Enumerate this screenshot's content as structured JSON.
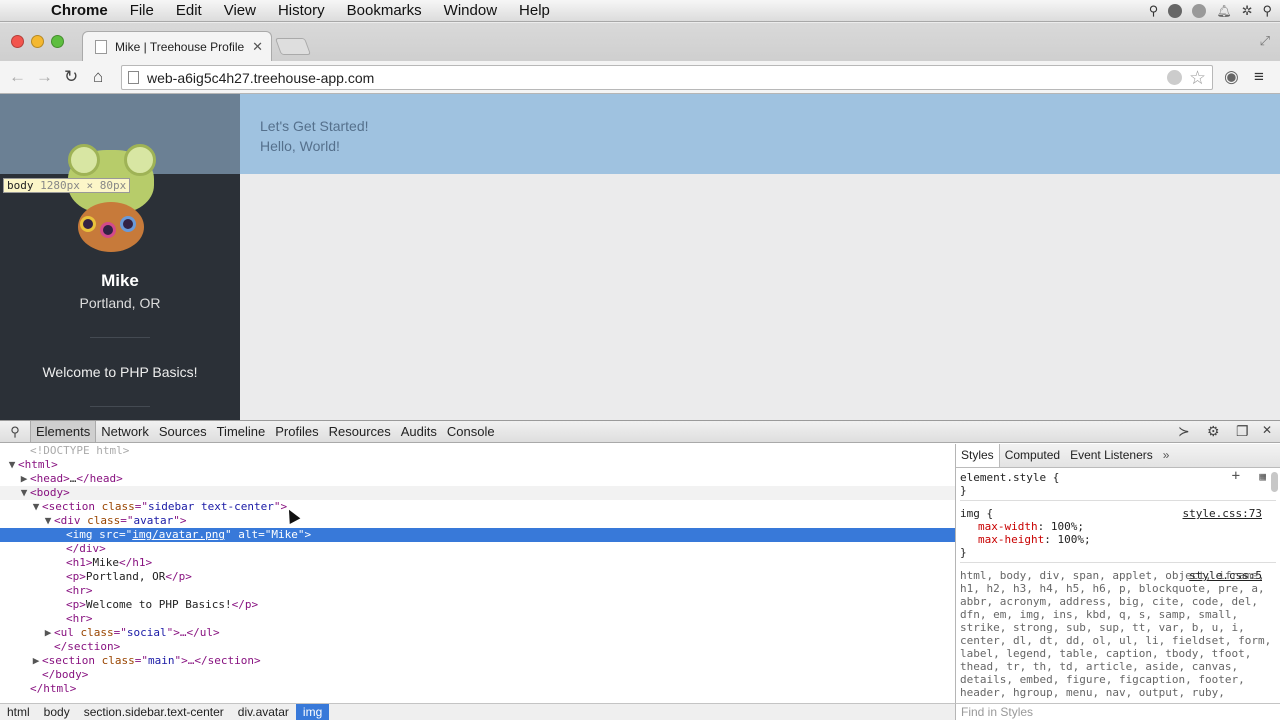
{
  "menubar": {
    "app": "Chrome",
    "items": [
      "File",
      "Edit",
      "View",
      "History",
      "Bookmarks",
      "Window",
      "Help"
    ]
  },
  "tab": {
    "title": "Mike | Treehouse Profile"
  },
  "toolbar": {
    "url": "web-a6ig5c4h27.treehouse-app.com"
  },
  "page": {
    "sidebar": {
      "name": "Mike",
      "location": "Portland, OR",
      "welcome": "Welcome to PHP Basics!"
    },
    "main": {
      "line1": "Let's Get Started!",
      "line2": "Hello, World!"
    },
    "tooltip": {
      "tag": "body",
      "size": "1280px × 80px"
    }
  },
  "devtools": {
    "tabs": [
      "Elements",
      "Network",
      "Sources",
      "Timeline",
      "Profiles",
      "Resources",
      "Audits",
      "Console"
    ],
    "active_tab": "Elements",
    "dom_lines": [
      {
        "indent": 1,
        "tri": "",
        "html": "<!DOCTYPE html>",
        "cls": "cm"
      },
      {
        "indent": 0,
        "tri": "▼",
        "html": "<html>"
      },
      {
        "indent": 1,
        "tri": "▶",
        "html": "<head>…</head>"
      },
      {
        "indent": 1,
        "tri": "▼",
        "html": "<body>",
        "hov": true
      },
      {
        "indent": 2,
        "tri": "▼",
        "html": "<section class=\"sidebar text-center\">"
      },
      {
        "indent": 3,
        "tri": "▼",
        "html": "<div class=\"avatar\">"
      },
      {
        "indent": 4,
        "tri": "",
        "html": "<img src=\"img/avatar.png\" alt=\"Mike\">",
        "sel": true
      },
      {
        "indent": 4,
        "tri": "",
        "html": "</div>"
      },
      {
        "indent": 4,
        "tri": "",
        "html": "<h1>Mike</h1>"
      },
      {
        "indent": 4,
        "tri": "",
        "html": "<p>Portland, OR</p>"
      },
      {
        "indent": 4,
        "tri": "",
        "html": "<hr>"
      },
      {
        "indent": 4,
        "tri": "",
        "html": "<p>Welcome to PHP Basics!</p>"
      },
      {
        "indent": 4,
        "tri": "",
        "html": "<hr>"
      },
      {
        "indent": 3,
        "tri": "▶",
        "html": "<ul class=\"social\">…</ul>"
      },
      {
        "indent": 3,
        "tri": "",
        "html": "</section>"
      },
      {
        "indent": 2,
        "tri": "▶",
        "html": "<section class=\"main\">…</section>"
      },
      {
        "indent": 2,
        "tri": "",
        "html": "</body>"
      },
      {
        "indent": 1,
        "tri": "",
        "html": "</html>"
      }
    ],
    "styles_tabs": [
      "Styles",
      "Computed",
      "Event Listeners"
    ],
    "rules": {
      "element_style_open": "element.style {",
      "element_style_close": "}",
      "img_selector": "img {",
      "img_source": "style.css:73",
      "img_prop1_name": "max-width",
      "img_prop1_value": "100%;",
      "img_prop2_name": "max-height",
      "img_prop2_value": "100%;",
      "img_close": "}",
      "reset_source": "style.css:5",
      "reset_selectors": "html, body, div, span, applet, object, iframe, h1, h2, h3, h4, h5, h6, p, blockquote, pre, a, abbr, acronym, address, big, cite, code, del, dfn, em, img, ins, kbd, q, s, samp, small, strike, strong, sub, sup, tt, var, b, u, i, center, dl, dt, dd, ol, ul, li, fieldset, form, label, legend, table, caption, tbody, tfoot, thead, tr, th, td, article, aside, canvas, details, embed, figure, figcaption, footer, header, hgroup, menu, nav, output, ruby,"
    },
    "breadcrumbs": [
      "html",
      "body",
      "section.sidebar.text-center",
      "div.avatar",
      "img"
    ],
    "find_placeholder": "Find in Styles"
  }
}
